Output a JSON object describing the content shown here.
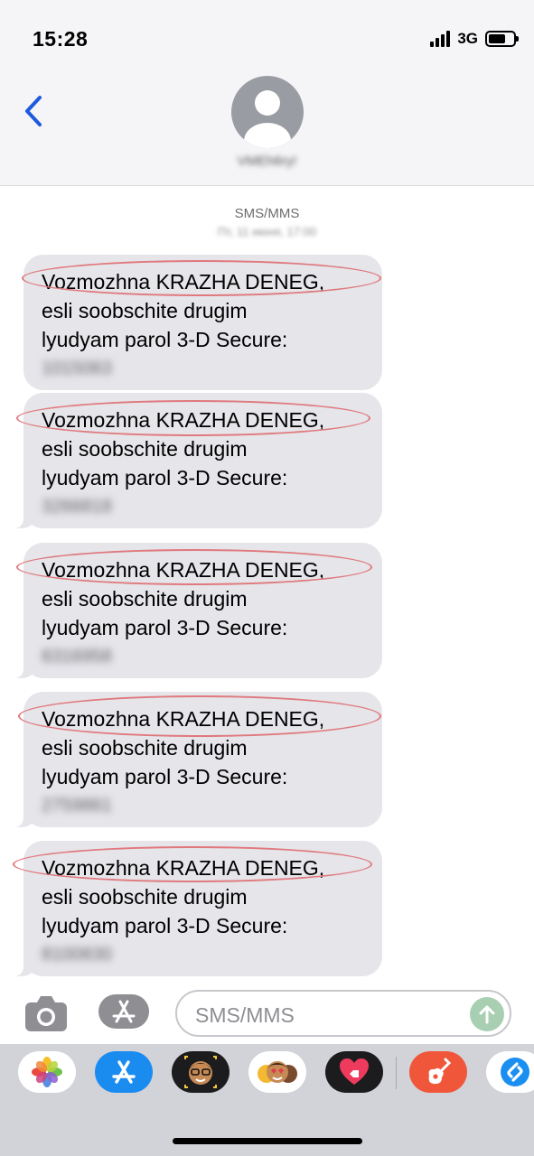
{
  "status_bar": {
    "time": "15:28",
    "network": "3G",
    "battery_level": 0.7
  },
  "header": {
    "back_icon": "chevron-left-icon",
    "contact_name": "VMEh6ry!",
    "avatar_icon": "person-icon"
  },
  "thread": {
    "service_label": "SMS/MMS",
    "timestamp": "Пт, 11 июня, 17:00",
    "messages": [
      {
        "line1": "Vozmozhna KRAZHA DENEG,",
        "line2": "esli soobschite drugim",
        "line3": "lyudyam parol 3-D Secure:",
        "code": "1015063"
      },
      {
        "line1": "Vozmozhna KRAZHA DENEG,",
        "line2": "esli soobschite drugim",
        "line3": "lyudyam parol 3-D Secure:",
        "code": "3266818"
      },
      {
        "line1": "Vozmozhna KRAZHA DENEG,",
        "line2": "esli soobschite drugim",
        "line3": "lyudyam parol 3-D Secure:",
        "code": "6316958"
      },
      {
        "line1": "Vozmozhna KRAZHA DENEG,",
        "line2": "esli soobschite drugim",
        "line3": "lyudyam parol 3-D Secure:",
        "code": "2759861"
      },
      {
        "line1": "Vozmozhna KRAZHA DENEG,",
        "line2": "esli soobschite drugim",
        "line3": "lyudyam parol 3-D Secure:",
        "code": "8100830"
      }
    ]
  },
  "composer": {
    "placeholder": "SMS/MMS",
    "camera_icon": "camera-icon",
    "apps_icon": "app-store-icon",
    "send_icon": "arrow-up-icon"
  },
  "app_tray": [
    {
      "icon": "photos-icon",
      "color": "#ffffff"
    },
    {
      "icon": "app-store-icon",
      "color": "#1a8cf0"
    },
    {
      "icon": "memoji-icon",
      "color": "#1c1c1e"
    },
    {
      "icon": "animoji-icon",
      "color": "#ffffff"
    },
    {
      "icon": "digital-touch-icon",
      "color": "#1c1c1e"
    },
    {
      "icon": "garageband-icon",
      "color": "#f0563a"
    },
    {
      "icon": "shazam-icon",
      "color": "#ffffff"
    }
  ],
  "colors": {
    "bubble": "#e5e5ea",
    "accent": "#1e5adf",
    "highlight": "#e0797d",
    "send": "#a9cfb2"
  }
}
